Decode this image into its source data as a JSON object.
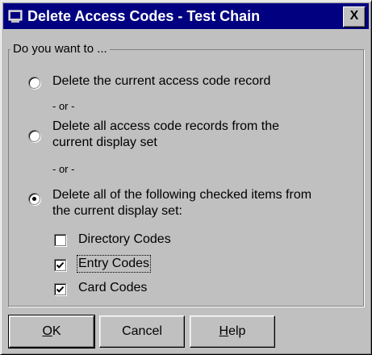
{
  "window": {
    "title": "Delete Access Codes - Test Chain",
    "icon": "app-icon",
    "close_label": "X"
  },
  "group": {
    "legend": "Do you want to ..."
  },
  "options": [
    {
      "label_lines": [
        "Delete the current access code record"
      ],
      "selected": false
    },
    {
      "label_lines": [
        "Delete all access code records from the",
        "current display set"
      ],
      "selected": false
    },
    {
      "label_lines": [
        "Delete all of the following checked items from",
        "the current display set:"
      ],
      "selected": true
    }
  ],
  "separators": [
    "- or -",
    "- or -"
  ],
  "checkboxes": [
    {
      "label": "Directory Codes",
      "checked": false,
      "focused": false
    },
    {
      "label": "Entry Codes",
      "checked": true,
      "focused": true
    },
    {
      "label": "Card Codes",
      "checked": true,
      "focused": false
    }
  ],
  "buttons": {
    "ok": {
      "mnemonic": "O",
      "rest": "K"
    },
    "cancel": {
      "label": "Cancel"
    },
    "help": {
      "mnemonic": "H",
      "rest": "elp"
    }
  },
  "colors": {
    "titlebar": "#000080",
    "face": "#c0c0c0",
    "shadow": "#808080"
  }
}
